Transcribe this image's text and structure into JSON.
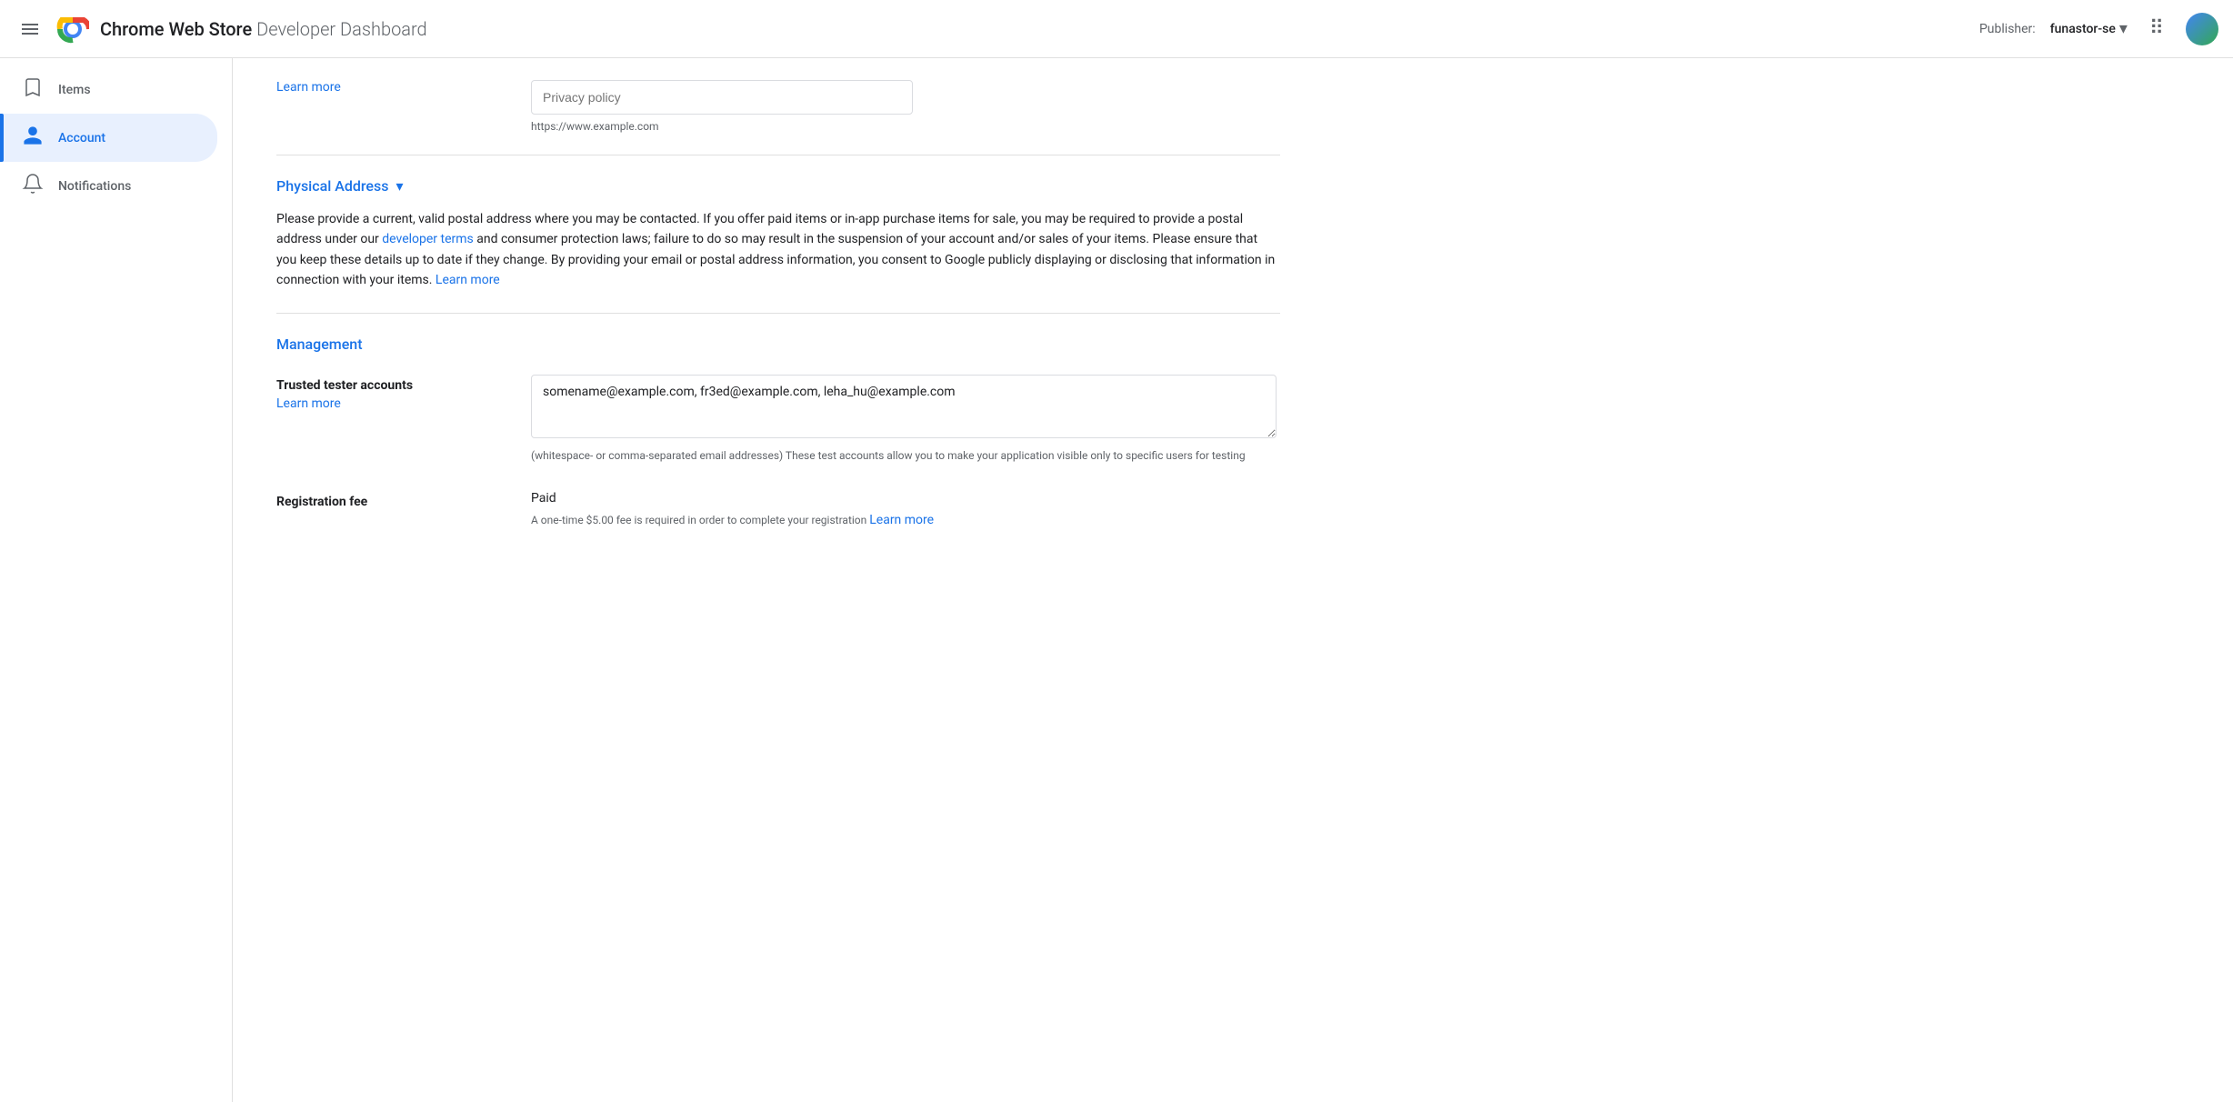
{
  "header": {
    "menu_icon": "☰",
    "app_title_bold": "Chrome Web Store",
    "app_title_light": "Developer Dashboard",
    "publisher_label": "Publisher:",
    "publisher_name": "funastor-se",
    "grid_icon": "⠿",
    "avatar_alt": "User avatar"
  },
  "sidebar": {
    "items": [
      {
        "id": "items",
        "label": "Items",
        "icon": "bookmark_border",
        "active": false
      },
      {
        "id": "account",
        "label": "Account",
        "icon": "account_circle",
        "active": true
      },
      {
        "id": "notifications",
        "label": "Notifications",
        "icon": "notifications_none",
        "active": false
      }
    ]
  },
  "main": {
    "privacy_policy": {
      "learn_more_label": "Learn more",
      "field_placeholder": "Privacy policy",
      "field_hint": "https://www.example.com"
    },
    "physical_address": {
      "title": "Physical Address",
      "description_part1": "Please provide a current, valid postal address where you may be contacted. If you offer paid items or in-app purchase items for sale, you may be required to provide a postal address under our ",
      "developer_terms_link": "developer terms",
      "description_part2": " and consumer protection laws; failure to do so may result in the suspension of your account and/or sales of your items. Please ensure that you keep these details up to date if they change. By providing your email or postal address information, you consent to Google publicly displaying or disclosing that information in connection with your items. ",
      "learn_more_link": "Learn more"
    },
    "management": {
      "title": "Management",
      "trusted_tester": {
        "label": "Trusted tester accounts",
        "learn_more_label": "Learn more",
        "value": "somename@example.com, fr3ed@example.com, leha_hu@example.com",
        "helper_text": "(whitespace- or comma-separated email addresses) These test accounts allow you to make your application visible only to specific users for testing"
      },
      "registration_fee": {
        "label": "Registration fee",
        "value": "Paid",
        "note_part1": "A one-time $5.00 fee is required in order to complete your registration ",
        "learn_more_link": "Learn more"
      }
    }
  }
}
